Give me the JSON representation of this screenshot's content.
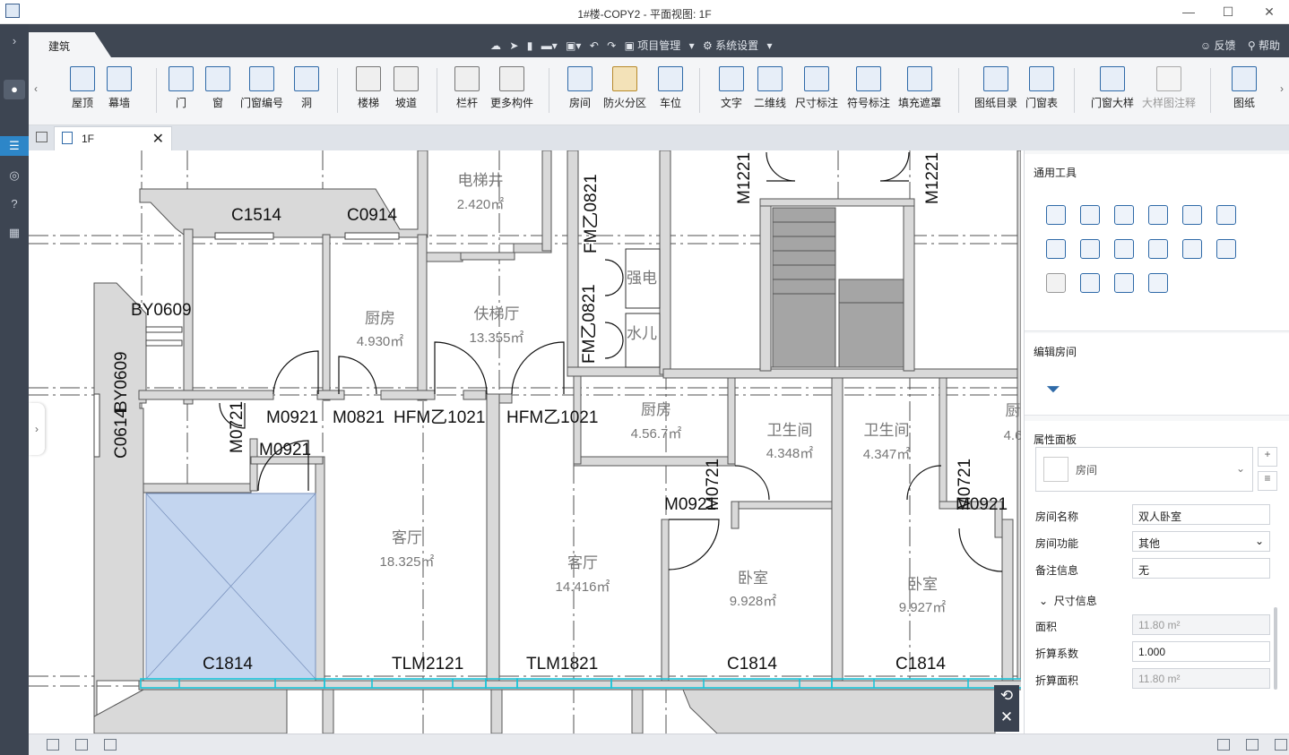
{
  "window": {
    "title": "1#楼-COPY2 - 平面视图: 1F",
    "minimize": "—",
    "maximize": "☐",
    "close": "✕"
  },
  "ribbon_head": {
    "active_tab": "建筑",
    "quick_icons": [
      "cloud-upload-icon",
      "send-icon",
      "document-icon",
      "folder-icon",
      "export-icon",
      "undo-icon",
      "redo-icon"
    ],
    "project_menu": "项目管理",
    "settings_menu": "系统设置",
    "feedback": "反馈",
    "help": "帮助"
  },
  "tools": [
    {
      "label": "屋顶"
    },
    {
      "label": "幕墙"
    },
    {
      "label": "门"
    },
    {
      "label": "窗"
    },
    {
      "label": "门窗编号"
    },
    {
      "label": "洞"
    },
    {
      "label": "楼梯"
    },
    {
      "label": "坡道"
    },
    {
      "label": "栏杆"
    },
    {
      "label": "更多构件"
    },
    {
      "label": "房间"
    },
    {
      "label": "防火分区"
    },
    {
      "label": "车位"
    },
    {
      "label": "文字"
    },
    {
      "label": "二维线"
    },
    {
      "label": "尺寸标注"
    },
    {
      "label": "符号标注"
    },
    {
      "label": "填充遮罩"
    },
    {
      "label": "图纸目录"
    },
    {
      "label": "门窗表"
    },
    {
      "label": "门窗大样"
    },
    {
      "label": "大样图注释"
    },
    {
      "label": "图纸"
    }
  ],
  "doc_tab": {
    "label": "1F",
    "close": "✕"
  },
  "panel": {
    "common_tools_title": "通用工具",
    "edit_room_title": "编辑房间",
    "properties_title": "属性面板",
    "type_name": "房间",
    "add_btn": "+",
    "list_btn": "≡",
    "props": [
      {
        "label": "房间名称",
        "value": "双人卧室"
      },
      {
        "label": "房间功能",
        "value": "其他"
      },
      {
        "label": "备注信息",
        "value": "无"
      }
    ],
    "size_section": "尺寸信息",
    "size_props": [
      {
        "label": "面积",
        "value": "11.80 m²"
      },
      {
        "label": "折算系数",
        "value": "1.000"
      },
      {
        "label": "折算面积",
        "value": "11.80 m²"
      }
    ]
  },
  "plan": {
    "labels": [
      "C1514",
      "C0914",
      "BY0609",
      "BY0609",
      "C0614",
      "M0721",
      "M0921",
      "M0821",
      "HFM乙1021",
      "HFM乙1021",
      "M0921",
      "FM乙0821",
      "FM乙0821",
      "M1221",
      "M1221",
      "M0921",
      "M0721",
      "M0721",
      "M0921",
      "C1814",
      "TLM2121",
      "TLM1821",
      "C1814",
      "C1814"
    ],
    "rooms": [
      {
        "name": "电梯井",
        "area": "2.420㎡"
      },
      {
        "name": "厨房",
        "area": "4.930㎡"
      },
      {
        "name": "伕梯厅",
        "area": "13.355㎡"
      },
      {
        "name": "强电",
        "area": ""
      },
      {
        "name": "水儿",
        "area": ""
      },
      {
        "name": "厨房",
        "area": "4.56.7㎡"
      },
      {
        "name": "卫生间",
        "area": "4.348㎡"
      },
      {
        "name": "卫生间",
        "area": "4.347㎡"
      },
      {
        "name": "厨",
        "area": "4.6"
      },
      {
        "name": "客厅",
        "area": "18.325㎡"
      },
      {
        "name": "客厅",
        "area": "14.416㎡"
      },
      {
        "name": "卧室",
        "area": "9.928㎡"
      },
      {
        "name": "卧室",
        "area": "9.927㎡"
      }
    ]
  }
}
